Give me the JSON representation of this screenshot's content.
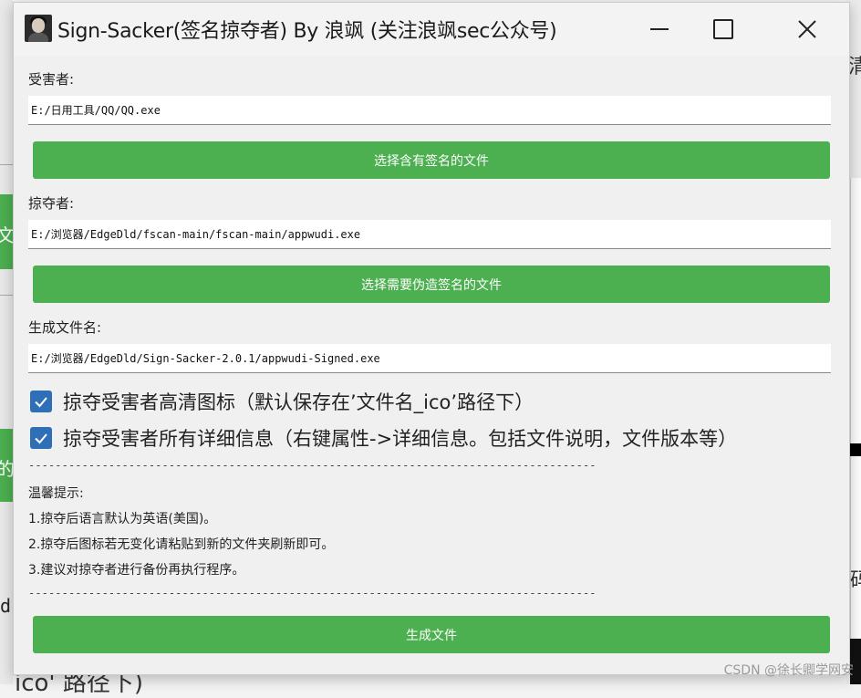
{
  "window": {
    "title": "Sign-Sacker(签名掠夺者) By 浪飒 (关注浪飒sec公众号)"
  },
  "victim": {
    "label": "受害者:",
    "value": "E:/日用工具/QQ/QQ.exe",
    "button": "选择含有签名的文件"
  },
  "plunderer": {
    "label": "掠夺者:",
    "value": "E:/浏览器/EdgeDld/fscan-main/fscan-main/appwudi.exe",
    "button": "选择需要伪造签名的文件"
  },
  "output": {
    "label": "生成文件名:",
    "value": "E:/浏览器/EdgeDld/Sign-Sacker-2.0.1/appwudi-Signed.exe"
  },
  "options": [
    {
      "label": "掠夺受害者高清图标（默认保存在’文件名_ico’路径下）",
      "checked": true
    },
    {
      "label": "掠夺受害者所有详细信息（右键属性->详细信息。包括文件说明，文件版本等）",
      "checked": true
    }
  ],
  "separator": "-------------------------------------------------------------------------------------",
  "tips": {
    "heading": "温馨提示:",
    "items": [
      "1.掠夺后语言默认为英语(美国)。",
      "2.掠夺后图标若无变化请粘贴到新的文件夹刷新即可。",
      "3.建议对掠夺者进行备份再执行程序。"
    ]
  },
  "generate_button": "生成文件",
  "background": {
    "left_char_1": "文",
    "left_char_2": "的",
    "left_char_3": "d",
    "right_char_1": "清",
    "right_char_2": "码",
    "bottom_text": "ico' 路径下)",
    "watermark": "CSDN @徐长卿学网安"
  },
  "colors": {
    "button_green": "#4caf50",
    "checkbox_blue": "#2f6fb8"
  }
}
